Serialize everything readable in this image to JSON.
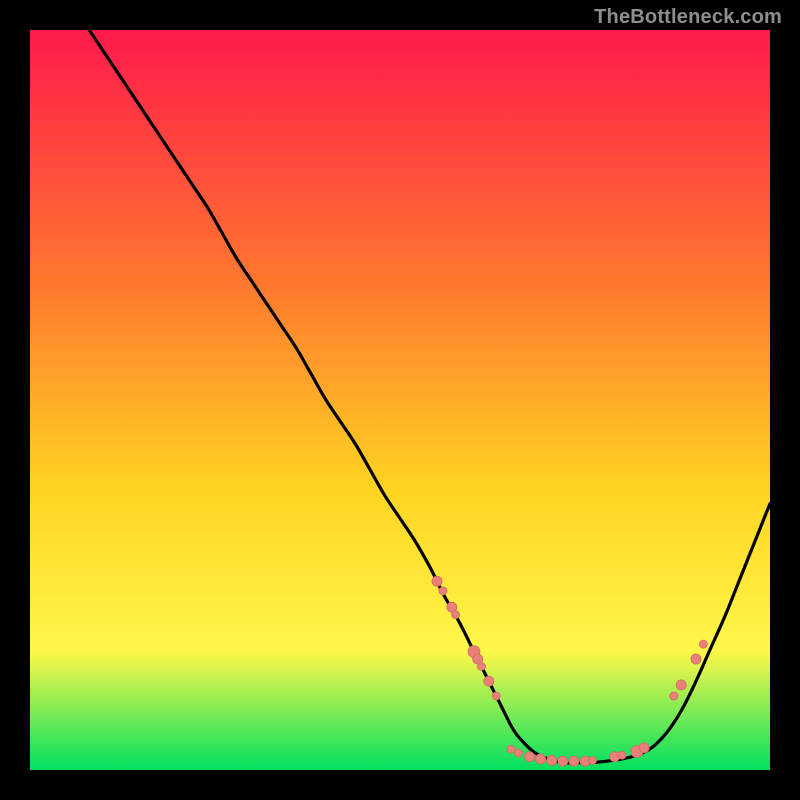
{
  "attribution": "TheBottleneck.com",
  "colors": {
    "gradient_top": "#ff1a4b",
    "gradient_mid1": "#ff7a2e",
    "gradient_mid2": "#ffd421",
    "gradient_mid3": "#fff74a",
    "gradient_bottom": "#00e060",
    "curve": "#000000",
    "marker_fill": "#e98079",
    "marker_stroke": "#d46a63"
  },
  "chart_data": {
    "type": "line",
    "title": "",
    "xlabel": "",
    "ylabel": "",
    "xlim": [
      0,
      100
    ],
    "ylim": [
      0,
      100
    ],
    "curve": {
      "x": [
        8,
        10,
        12,
        14,
        16,
        18,
        20,
        22,
        24,
        26,
        28,
        30,
        32,
        34,
        36,
        38,
        40,
        42,
        44,
        46,
        48,
        50,
        52,
        54,
        55,
        56,
        58,
        60,
        62,
        64,
        65,
        66,
        68,
        70,
        72,
        74,
        76,
        78,
        80,
        82,
        84,
        86,
        88,
        90,
        92,
        94,
        96,
        98,
        100
      ],
      "y": [
        100,
        97,
        94,
        91,
        88,
        85,
        82,
        79,
        76,
        72.5,
        69,
        66,
        63,
        60,
        57,
        53.5,
        50,
        47,
        44,
        40.5,
        37,
        34,
        31,
        27.5,
        25.5,
        23.5,
        20,
        16,
        12,
        8,
        6,
        4.5,
        2.5,
        1.5,
        1,
        1,
        1,
        1.2,
        1.5,
        2,
        3,
        5,
        8,
        12,
        16.5,
        21,
        26,
        31,
        36
      ]
    },
    "markers": [
      {
        "x": 55,
        "y": 25.5,
        "r": 5
      },
      {
        "x": 55.8,
        "y": 24.2,
        "r": 4
      },
      {
        "x": 57,
        "y": 22,
        "r": 5
      },
      {
        "x": 57.5,
        "y": 21,
        "r": 4
      },
      {
        "x": 60,
        "y": 16,
        "r": 6
      },
      {
        "x": 60.5,
        "y": 15,
        "r": 5
      },
      {
        "x": 61,
        "y": 14,
        "r": 4
      },
      {
        "x": 62,
        "y": 12,
        "r": 5
      },
      {
        "x": 63,
        "y": 10,
        "r": 4
      },
      {
        "x": 65,
        "y": 2.8,
        "r": 4
      },
      {
        "x": 66,
        "y": 2.3,
        "r": 4
      },
      {
        "x": 67.5,
        "y": 1.8,
        "r": 5
      },
      {
        "x": 69,
        "y": 1.5,
        "r": 5
      },
      {
        "x": 70.5,
        "y": 1.3,
        "r": 5
      },
      {
        "x": 72,
        "y": 1.2,
        "r": 5
      },
      {
        "x": 73.5,
        "y": 1.2,
        "r": 5
      },
      {
        "x": 75,
        "y": 1.2,
        "r": 5
      },
      {
        "x": 76,
        "y": 1.3,
        "r": 4
      },
      {
        "x": 79,
        "y": 1.8,
        "r": 5
      },
      {
        "x": 80,
        "y": 2,
        "r": 4
      },
      {
        "x": 82,
        "y": 2.5,
        "r": 6
      },
      {
        "x": 83,
        "y": 3,
        "r": 5
      },
      {
        "x": 87,
        "y": 10,
        "r": 4
      },
      {
        "x": 88,
        "y": 11.5,
        "r": 5
      },
      {
        "x": 90,
        "y": 15,
        "r": 5
      },
      {
        "x": 91,
        "y": 17,
        "r": 4
      }
    ]
  }
}
